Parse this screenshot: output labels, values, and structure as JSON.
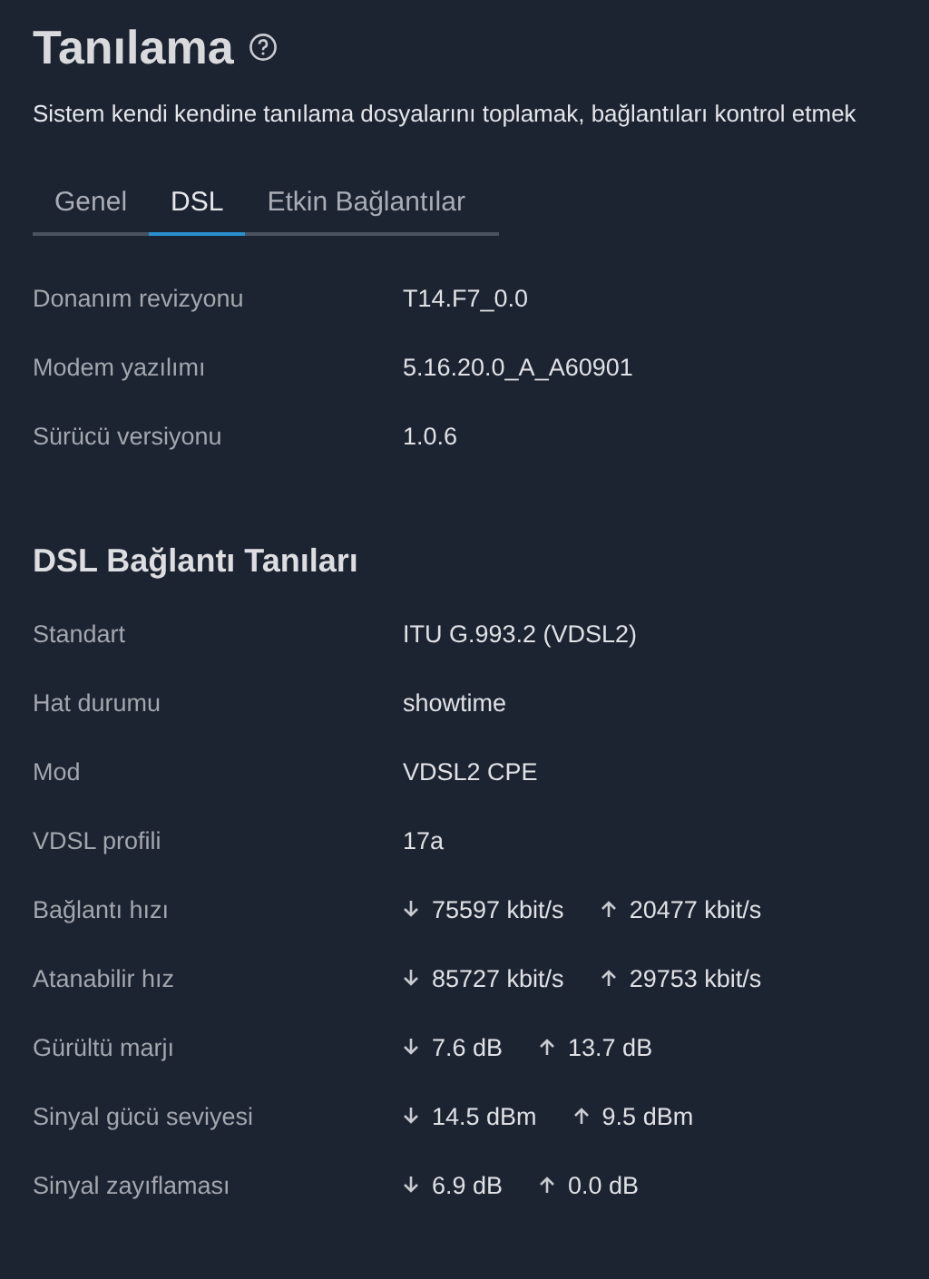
{
  "page": {
    "title": "Tanılama",
    "description": "Sistem kendi kendine tanılama dosyalarını toplamak, bağlantıları kontrol etmek"
  },
  "tabs": [
    {
      "label": "Genel",
      "selected": false
    },
    {
      "label": "DSL",
      "selected": true
    },
    {
      "label": "Etkin Bağlantılar",
      "selected": false
    }
  ],
  "device_info": [
    {
      "label": "Donanım revizyonu",
      "kind": "text",
      "value": "T14.F7_0.0"
    },
    {
      "label": "Modem yazılımı",
      "kind": "text",
      "value": "5.16.20.0_A_A60901"
    },
    {
      "label": "Sürücü versiyonu",
      "kind": "text",
      "value": "1.0.6"
    }
  ],
  "dsl_section": {
    "title": "DSL Bağlantı Tanıları",
    "rows": [
      {
        "label": "Standart",
        "kind": "text",
        "value": "ITU G.993.2 (VDSL2)"
      },
      {
        "label": "Hat durumu",
        "kind": "text",
        "value": "showtime"
      },
      {
        "label": "Mod",
        "kind": "text",
        "value": "VDSL2 CPE"
      },
      {
        "label": "VDSL profili",
        "kind": "text",
        "value": "17a"
      },
      {
        "label": "Bağlantı hızı",
        "kind": "updown",
        "down": "75597 kbit/s",
        "up": "20477 kbit/s"
      },
      {
        "label": "Atanabilir hız",
        "kind": "updown",
        "down": "85727 kbit/s",
        "up": "29753 kbit/s"
      },
      {
        "label": "Gürültü marjı",
        "kind": "updown",
        "down": "7.6 dB",
        "up": "13.7 dB"
      },
      {
        "label": "Sinyal gücü seviyesi",
        "kind": "updown",
        "down": "14.5 dBm",
        "up": "9.5 dBm"
      },
      {
        "label": "Sinyal zayıflaması",
        "kind": "updown",
        "down": "6.9 dB",
        "up": "0.0 dB"
      }
    ]
  }
}
